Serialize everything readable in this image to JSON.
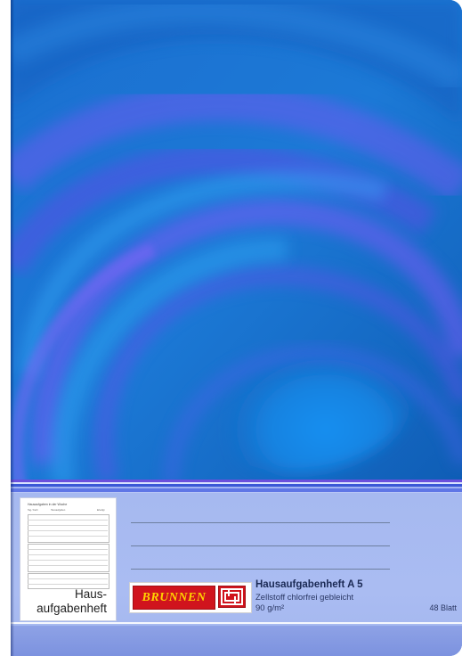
{
  "cover": {
    "colors": {
      "base_blue": "#1f78d2",
      "dark_blue": "#0b55aa",
      "light_blue": "#2e95e8",
      "violet": "#5a53e0",
      "label_lavender": "#a8baf1"
    }
  },
  "planner_page": {
    "header_title": "Hausaufgaben in der Woche",
    "column_headers": [
      "Tag / Fach",
      "Hausaufgaben",
      "Erledigt"
    ],
    "caption_line1": "Haus-",
    "caption_line2": "aufgabenheft"
  },
  "brand": {
    "name": "BRUNNEN",
    "logo_colors": {
      "background": "#d0141d",
      "text": "#ffd200"
    },
    "icon": "brunnen-maze-icon"
  },
  "product": {
    "name": "Hausaufgabenheft A 5",
    "paper": "Zellstoff chlorfrei gebleicht",
    "weight": "90 g/m²",
    "sheets": "48 Blatt"
  }
}
